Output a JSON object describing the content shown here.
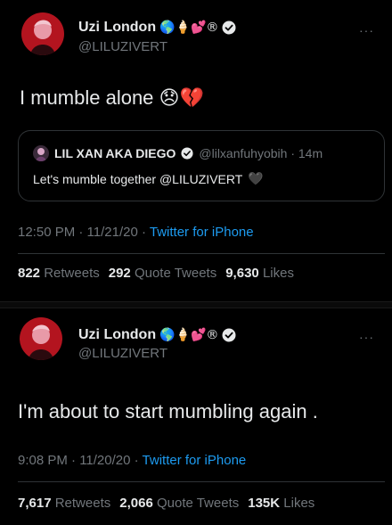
{
  "tweets": [
    {
      "author": {
        "name": "Uzi London",
        "emojis": "🌎🍦💕®",
        "handle": "@LILUZIVERT"
      },
      "more_label": "···",
      "text": "I mumble alone 😞💔",
      "quote": {
        "author_name": "LIL XAN AKA DIEGO",
        "handle_time": "@lilxanfuhyobih · 14m",
        "text": "Let's mumble together @LILUZIVERT",
        "text_emoji": "🖤"
      },
      "time": "12:50 PM · 11/21/20 · ",
      "app": "Twitter for iPhone",
      "stats": {
        "retweets": "822",
        "retweets_label": "Retweets",
        "quotes": "292",
        "quotes_label": "Quote Tweets",
        "likes": "9,630",
        "likes_label": "Likes"
      }
    },
    {
      "author": {
        "name": "Uzi London",
        "emojis": "🌎🍦💕®",
        "handle": "@LILUZIVERT"
      },
      "more_label": "···",
      "text": "I'm about to start mumbling again .",
      "time": "9:08 PM · 11/20/20 · ",
      "app": "Twitter for iPhone",
      "stats": {
        "retweets": "7,617",
        "retweets_label": "Retweets",
        "quotes": "2,066",
        "quotes_label": "Quote Tweets",
        "likes": "135K",
        "likes_label": "Likes"
      }
    }
  ],
  "colors": {
    "background": "#000000",
    "text": "#e7e9ea",
    "secondary": "#71767b",
    "link": "#1d9bf0",
    "border": "#2f3336"
  }
}
